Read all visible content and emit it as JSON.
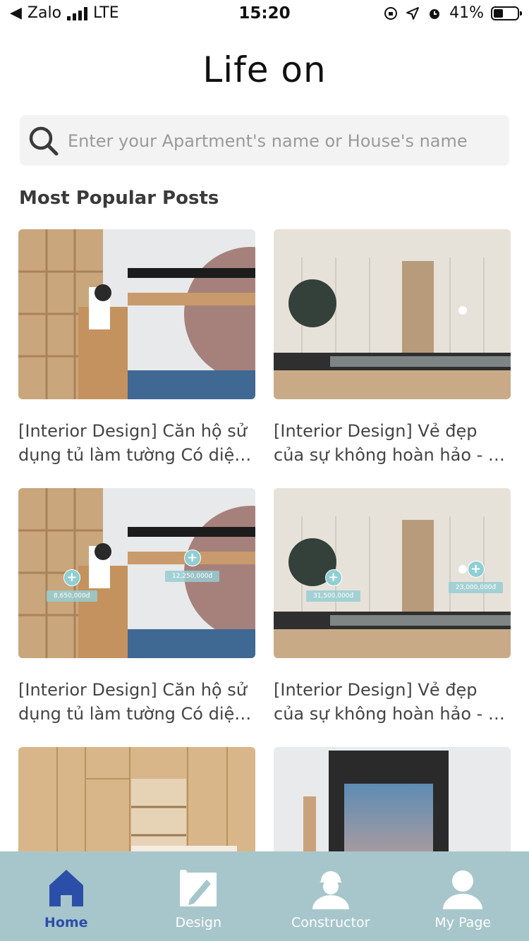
{
  "status_bar": {
    "back_app": "Zalo",
    "network": "LTE",
    "time": "15:20",
    "battery": "41%",
    "battery_level": 0.41
  },
  "header": {
    "logo": "Life on"
  },
  "search": {
    "placeholder": "Enter your Apartment's name or House's name"
  },
  "section": {
    "title": "Most Popular Posts"
  },
  "posts": [
    {
      "title": "[Interior Design] Căn hộ sử dụng tủ làm tường Có diện tích…",
      "tags": []
    },
    {
      "title": "[Interior Design] Vẻ đẹp của sự không hoàn hảo - …",
      "tags": []
    },
    {
      "title": "[Interior Design] Căn hộ sử dụng tủ làm tường Có diện tích…",
      "tags": [
        "8,650,000đ",
        "12,250,000đ"
      ]
    },
    {
      "title": "[Interior Design] Vẻ đẹp của sự không hoàn hảo - …",
      "tags": [
        "31,500,000đ",
        "23,000,000đ"
      ]
    }
  ],
  "tabbar": {
    "items": [
      {
        "label": "Home",
        "icon": "home-icon",
        "active": true
      },
      {
        "label": "Design",
        "icon": "design-icon",
        "active": false
      },
      {
        "label": "Constructor",
        "icon": "constructor-icon",
        "active": false
      },
      {
        "label": "My Page",
        "icon": "user-icon",
        "active": false
      }
    ]
  },
  "colors": {
    "tabbar_bg": "#a7c6cb",
    "active_tab": "#2b4fa8",
    "tag_accent": "#8fcfd3"
  }
}
